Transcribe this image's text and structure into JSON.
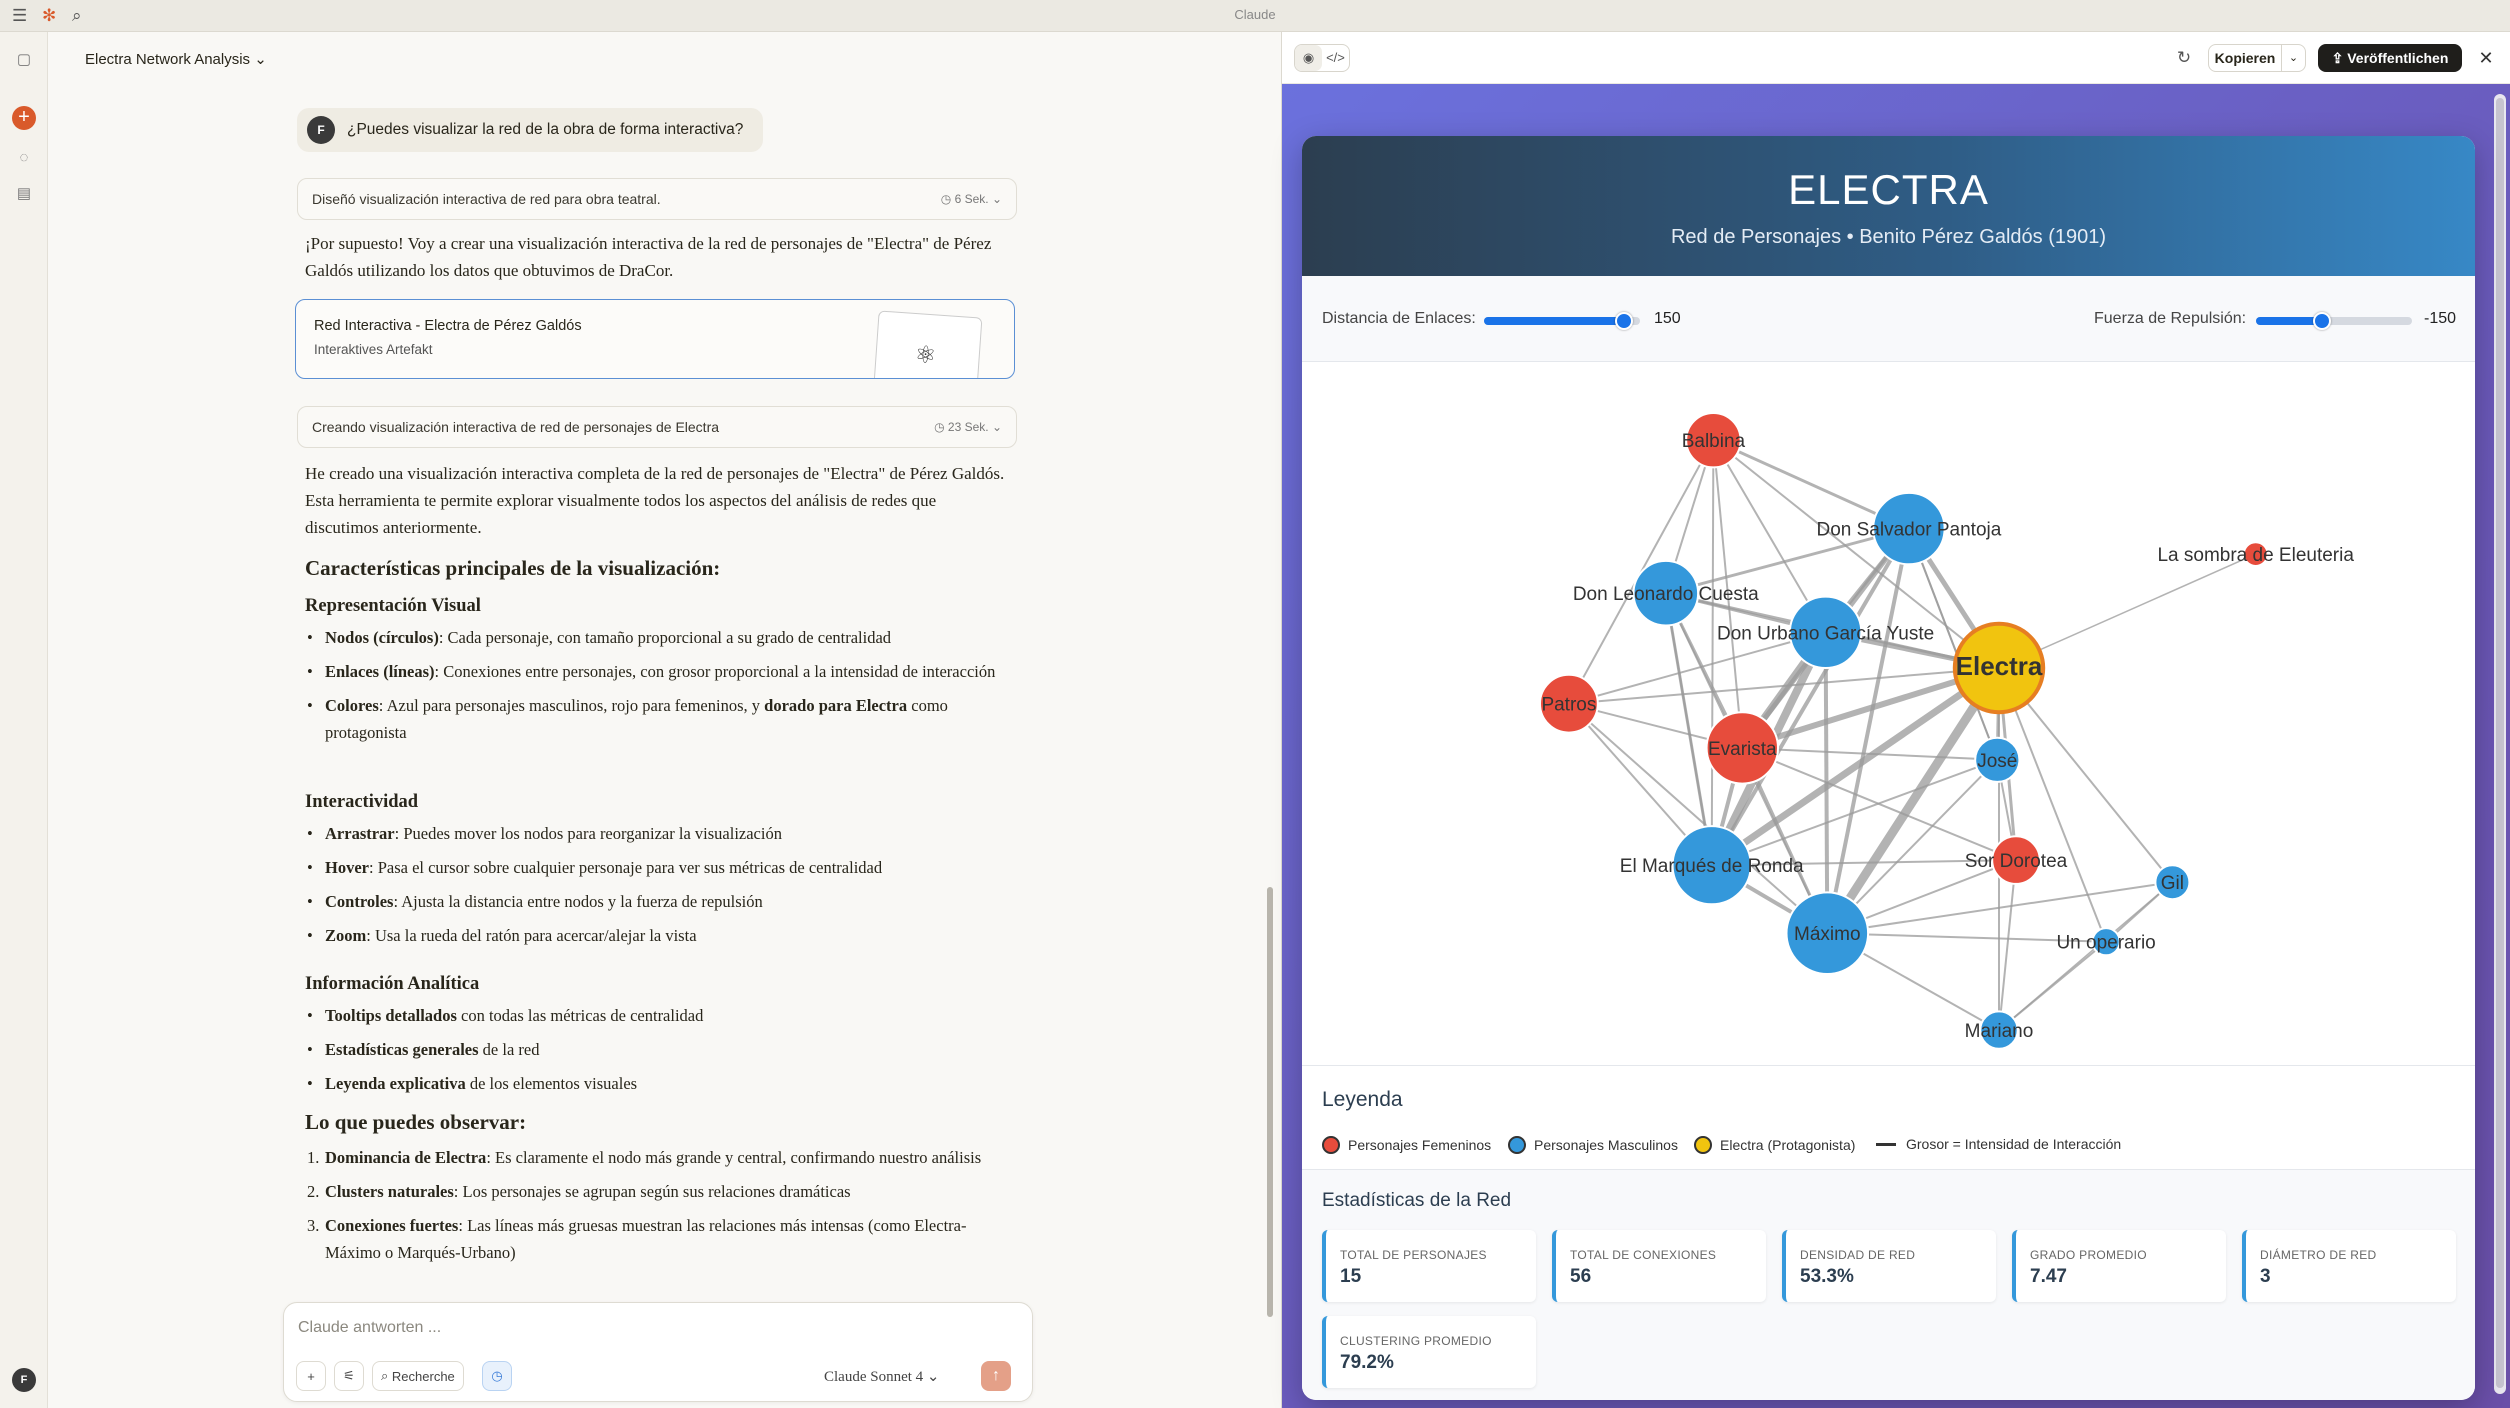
{
  "window": {
    "title": "Claude"
  },
  "chat": {
    "title": "Electra Network Analysis",
    "user_initial": "F",
    "user_message": "¿Puedes visualizar la red de la obra de forma interactiva?",
    "thinking1": {
      "label": "Diseñó visualización interactiva de red para obra teatral.",
      "duration": "6 Sek."
    },
    "intro": "¡Por supuesto! Voy a crear una visualización interactiva de la red de personajes de \"Electra\" de Pérez Galdós utilizando los datos que obtuvimos de DraCor.",
    "artifact": {
      "title": "Red Interactiva - Electra de Pérez Galdós",
      "subtitle": "Interaktives Artefakt"
    },
    "thinking2": {
      "label": "Creando visualización interactiva de red de personajes de Electra",
      "duration": "23 Sek."
    },
    "summary": "He creado una visualización interactiva completa de la red de personajes de \"Electra\" de Pérez Galdós. Esta herramienta te permite explorar visualmente todos los aspectos del análisis de redes que discutimos anteriormente.",
    "h_features": "Características principales de la visualización:",
    "h_visual": "Representación Visual",
    "visual_items": [
      {
        "bold": "Nodos (círculos)",
        "text": ": Cada personaje, con tamaño proporcional a su grado de centralidad"
      },
      {
        "bold": "Enlaces (líneas)",
        "text": ": Conexiones entre personajes, con grosor proporcional a la intensidad de interacción"
      },
      {
        "bold": "Colores",
        "text": ": Azul para personajes masculinos, rojo para femeninos, y ",
        "bold2": "dorado para Electra",
        "text2": " como protagonista"
      }
    ],
    "h_interactivity": "Interactividad",
    "interactivity_items": [
      {
        "bold": "Arrastrar",
        "text": ": Puedes mover los nodos para reorganizar la visualización"
      },
      {
        "bold": "Hover",
        "text": ": Pasa el cursor sobre cualquier personaje para ver sus métricas de centralidad"
      },
      {
        "bold": "Controles",
        "text": ": Ajusta la distancia entre nodos y la fuerza de repulsión"
      },
      {
        "bold": "Zoom",
        "text": ": Usa la rueda del ratón para acercar/alejar la vista"
      }
    ],
    "h_analytic": "Información Analítica",
    "analytic_items": [
      {
        "bold": "Tooltips detallados",
        "text": " con todas las métricas de centralidad"
      },
      {
        "bold": "Estadísticas generales",
        "text": " de la red"
      },
      {
        "bold": "Leyenda explicativa",
        "text": " de los elementos visuales"
      }
    ],
    "h_observe": "Lo que puedes observar:",
    "observe_items": [
      {
        "num": "1.",
        "bold": "Dominancia de Electra",
        "text": ": Es claramente el nodo más grande y central, confirmando nuestro análisis"
      },
      {
        "num": "2.",
        "bold": "Clusters naturales",
        "text": ": Los personajes se agrupan según sus relaciones dramáticas"
      },
      {
        "num": "3.",
        "bold": "Conexiones fuertes",
        "text": ": Las líneas más gruesas muestran las relaciones más intensas (como Electra-Máximo o Marqués-Urbano)"
      }
    ],
    "composer": {
      "placeholder": "Claude antworten ...",
      "research": "Recherche",
      "model": "Claude Sonnet 4"
    }
  },
  "pane": {
    "copy_label": "Kopieren",
    "publish_label": "Veröffentlichen",
    "hero": {
      "title": "ELECTRA",
      "subtitle": "Red de Personajes • Benito Pérez Galdós (1901)"
    },
    "controls": {
      "link_label": "Distancia de Enlaces:",
      "link_value": "150",
      "link_level": 0.9,
      "repulsion_label": "Fuerza de Repulsión:",
      "repulsion_value": "-150",
      "repulsion_level": 0.42
    },
    "colors": {
      "female": "#e74c3c",
      "male": "#3498db",
      "protagonist": "#f1c40f",
      "link": "#999999"
    },
    "nodes": [
      {
        "id": "Electra",
        "type": "protagonist"
      },
      {
        "id": "Balbina",
        "type": "female"
      },
      {
        "id": "Don Salvador Pantoja",
        "type": "male"
      },
      {
        "id": "La sombra de Eleuteria",
        "type": "female"
      },
      {
        "id": "Don Leonardo Cuesta",
        "type": "male"
      },
      {
        "id": "Don Urbano García Yuste",
        "type": "male"
      },
      {
        "id": "Patros",
        "type": "female"
      },
      {
        "id": "Evarista",
        "type": "female"
      },
      {
        "id": "José",
        "type": "male"
      },
      {
        "id": "El Marqués de Ronda",
        "type": "male"
      },
      {
        "id": "Sor Dorotea",
        "type": "female"
      },
      {
        "id": "Gil",
        "type": "male"
      },
      {
        "id": "Máximo",
        "type": "male"
      },
      {
        "id": "Un operario",
        "type": "male"
      },
      {
        "id": "Mariano",
        "type": "male"
      }
    ],
    "legend": {
      "title": "Leyenda",
      "female": "Personajes Femeninos",
      "male": "Personajes Masculinos",
      "protagonist": "Electra (Protagonista)",
      "thickness": "Grosor = Intensidad de Interacción"
    },
    "stats": {
      "title": "Estadísticas de la Red",
      "items": [
        {
          "label": "TOTAL DE PERSONAJES",
          "value": "15"
        },
        {
          "label": "TOTAL DE CONEXIONES",
          "value": "56"
        },
        {
          "label": "DENSIDAD DE RED",
          "value": "53.3%"
        },
        {
          "label": "GRADO PROMEDIO",
          "value": "7.47"
        },
        {
          "label": "DIÁMETRO DE RED",
          "value": "3"
        },
        {
          "label": "CLUSTERING PROMEDIO",
          "value": "79.2%"
        }
      ]
    }
  }
}
